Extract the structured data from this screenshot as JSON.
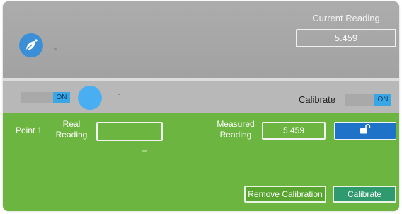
{
  "header": {
    "current_reading_label": "Current Reading",
    "current_reading_value": "5.459",
    "logo_icon": "leaf-icon"
  },
  "controls": {
    "left_toggle_label": "ON",
    "calibrate_label": "Calibrate",
    "calibrate_toggle_label": "ON"
  },
  "calibration": {
    "point_label": "Point 1",
    "real_reading_label": "Real\nReading",
    "real_reading_value": "",
    "measured_reading_label": "Measured\nReading",
    "measured_reading_value": "5.459",
    "lock_icon": "unlock-icon",
    "remove_button": "Remove Calibration",
    "calibrate_button": "Calibrate"
  },
  "colors": {
    "panel_gray": "#a6a6a6",
    "green": "#6db541",
    "accent_blue": "#39a7e6",
    "button_blue": "#1e72c8",
    "button_teal": "#2e9a6e"
  }
}
